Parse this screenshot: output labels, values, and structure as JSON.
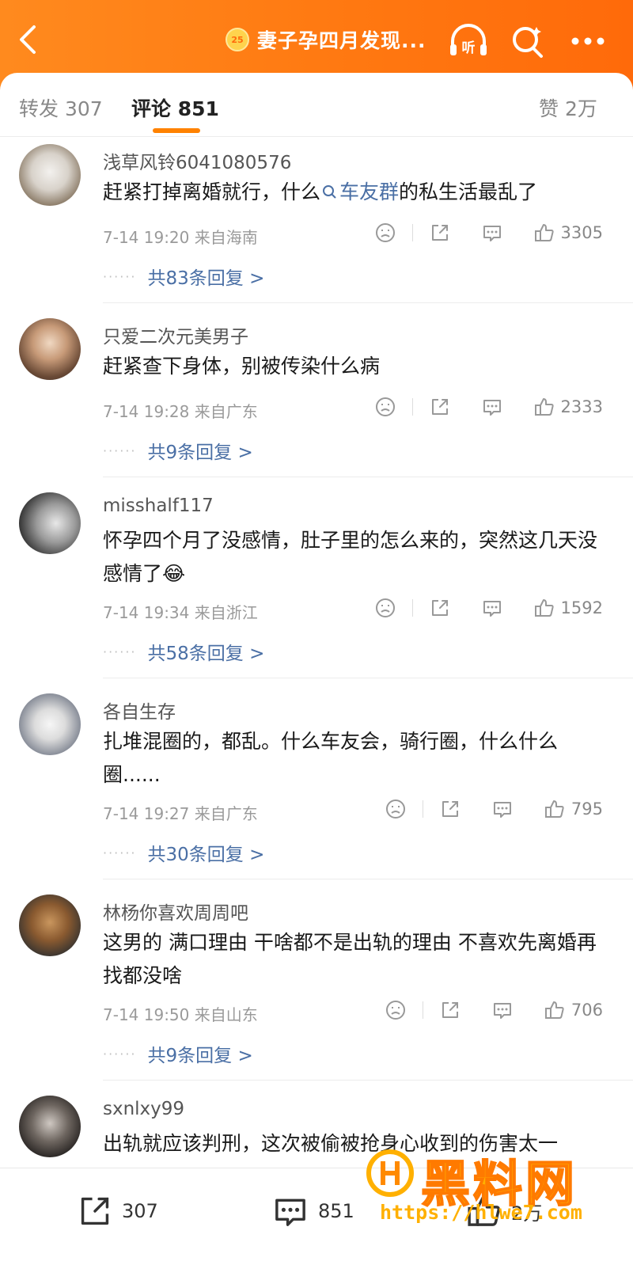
{
  "header": {
    "title": "妻子孕四月发现...",
    "badge_text": "25",
    "listen_label": "听"
  },
  "tabs": {
    "repost": "转发 307",
    "comments": "评论 851",
    "likes": "赞 2万"
  },
  "comments": [
    {
      "user": "浅草风铃6041080576",
      "text_before": "赶紧打掉离婚就行，什么",
      "topic": "车友群",
      "text_after": "的私生活最乱了",
      "time": "7-14 19:20",
      "location": "来自海南",
      "likes": "3305",
      "replies": "共83条回复 >"
    },
    {
      "user": "只爱二次元美男子",
      "text": "赶紧查下身体，别被传染什么病",
      "time": "7-14 19:28",
      "location": "来自广东",
      "likes": "2333",
      "replies": "共9条回复 >"
    },
    {
      "user": "misshalf117",
      "text": "怀孕四个月了没感情，肚子里的怎么来的，突然这几天没感情了",
      "emoji": "😂",
      "time": "7-14 19:34",
      "location": "来自浙江",
      "likes": "1592",
      "replies": "共58条回复 >"
    },
    {
      "user": "各自生存",
      "text": "扎堆混圈的，都乱。什么车友会，骑行圈，什么什么圈......",
      "time": "7-14 19:27",
      "location": "来自广东",
      "likes": "795",
      "replies": "共30条回复 >"
    },
    {
      "user": "林杨你喜欢周周吧",
      "text": "这男的 满口理由 干啥都不是出轨的理由 不喜欢先离婚再找都没啥",
      "time": "7-14 19:50",
      "location": "来自山东",
      "likes": "706",
      "replies": "共9条回复 >"
    },
    {
      "user": "sxnlxy99",
      "text": "出轨就应该判刑，这次被偷被抢身心收到的伤害太一"
    }
  ],
  "bottom_bar": {
    "reposts": "307",
    "comments": "851",
    "likes": "2万"
  },
  "watermark": {
    "brand": "黑料网",
    "url": "https://hlwe7.com"
  },
  "colors": {
    "header_orange": "#ff7a12",
    "accent": "#ff8200",
    "link_blue": "#4a6fa5"
  }
}
